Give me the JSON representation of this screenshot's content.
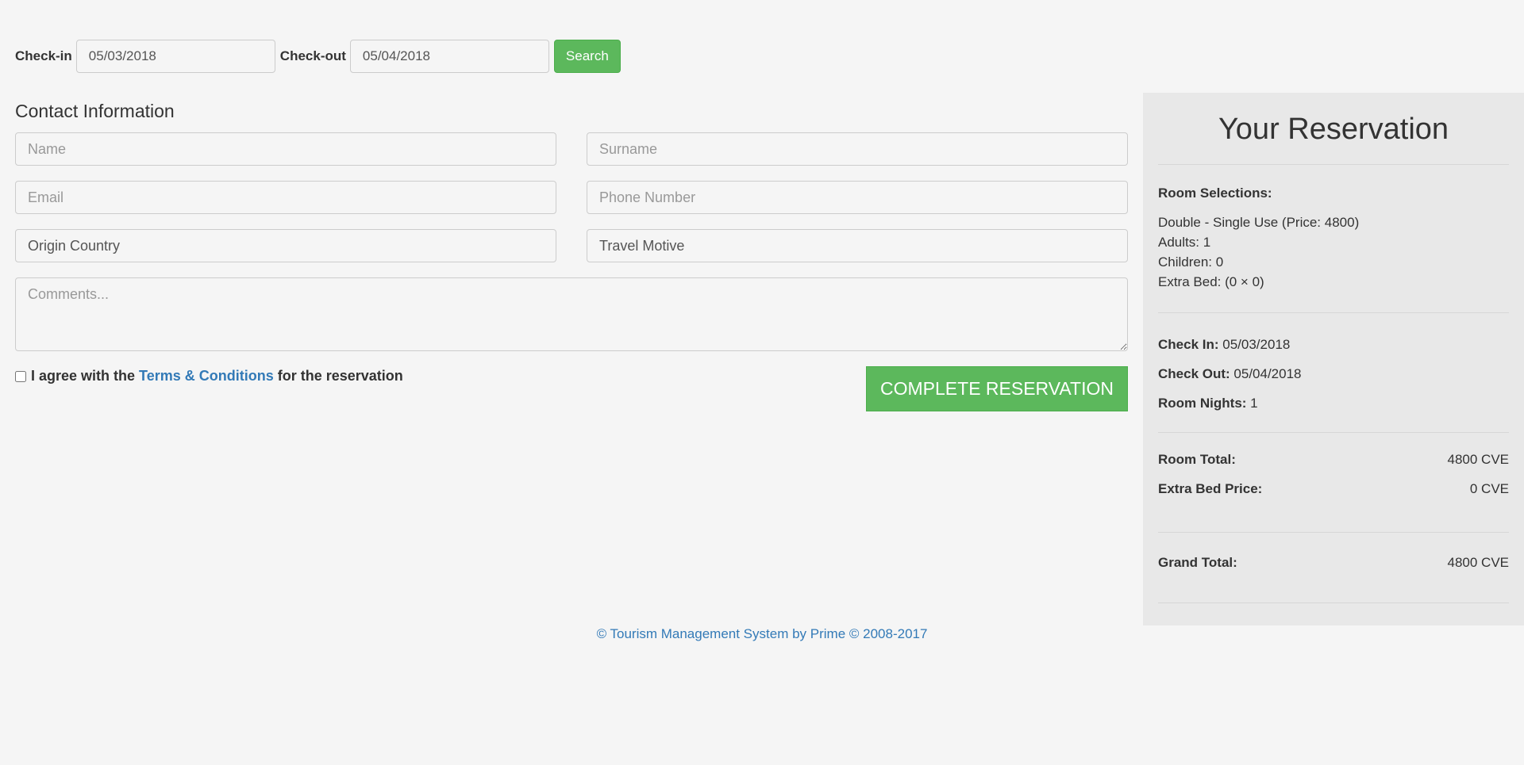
{
  "search": {
    "checkin_label": "Check-in",
    "checkin_value": "05/03/2018",
    "checkout_label": "Check-out",
    "checkout_value": "05/04/2018",
    "button_label": "Search"
  },
  "contact": {
    "title": "Contact Information",
    "name_placeholder": "Name",
    "surname_placeholder": "Surname",
    "email_placeholder": "Email",
    "phone_placeholder": "Phone Number",
    "origin_country_value": "Origin Country",
    "travel_motive_value": "Travel Motive",
    "comments_placeholder": "Comments..."
  },
  "agreement": {
    "prefix": "I agree with the",
    "link_text": "Terms & Conditions",
    "suffix": "for the reservation",
    "checked": false
  },
  "complete_button_label": "COMPLETE RESERVATION",
  "reservation": {
    "title": "Your Reservation",
    "room_selections_label": "Room Selections:",
    "room_lines": [
      "Double - Single Use (Price: 4800)",
      "Adults: 1",
      "Children: 0",
      "Extra Bed: (0 × 0)"
    ],
    "check_in_label": "Check In:",
    "check_in_value": "05/03/2018",
    "check_out_label": "Check Out:",
    "check_out_value": "05/04/2018",
    "room_nights_label": "Room Nights:",
    "room_nights_value": "1",
    "room_total_label": "Room Total:",
    "room_total_value": "4800 CVE",
    "extra_bed_price_label": "Extra Bed Price:",
    "extra_bed_price_value": "0 CVE",
    "grand_total_label": "Grand Total:",
    "grand_total_value": "4800 CVE"
  },
  "footer": {
    "text": "© Tourism Management System by Prime © 2008-2017"
  },
  "colors": {
    "page_background": "#f5f5f5",
    "panel_background": "#e8e8e8",
    "success_green": "#5cb85c",
    "link_blue": "#337ab7"
  }
}
